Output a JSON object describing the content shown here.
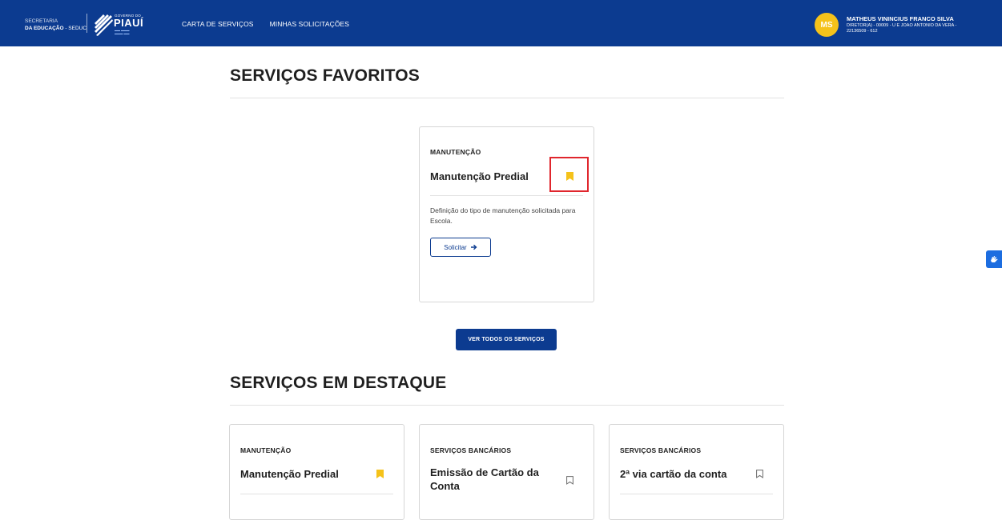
{
  "header": {
    "brand_line1": "SECRETARIA",
    "brand_line2_bold": "DA EDUCAÇÃO",
    "brand_line2_rest": " - SEDUC",
    "gov_small": "GOVERNO DO",
    "gov_big": "PIAUÍ",
    "nav": [
      "CARTA DE SERVIÇOS",
      "MINHAS SOLICITAÇÕES"
    ],
    "user_initials": "MS",
    "user_name": "MATHEUS VININCIUS FRANCO SILVA",
    "user_role": "DIRETOR(A) - 00009 - U E JOAO ANTONIO DA VERA - 22136509 - 612"
  },
  "favorites": {
    "title": "SERVIÇOS FAVORITOS",
    "card": {
      "category": "MANUTENÇÃO",
      "title": "Manutenção Predial",
      "description": "Definição do tipo de manutenção solicitada para Escola.",
      "button": "Solicitar"
    },
    "view_all": "VER TODOS OS SERVIÇOS"
  },
  "featured": {
    "title": "SERVIÇOS EM DESTAQUE",
    "cards": [
      {
        "category": "MANUTENÇÃO",
        "title": "Manutenção Predial"
      },
      {
        "category": "SERVIÇOS BANCÁRIOS",
        "title": "Emissão de Cartão da Conta"
      },
      {
        "category": "SERVIÇOS BANCÁRIOS",
        "title": "2ª via cartão da conta"
      }
    ]
  },
  "colors": {
    "primary": "#0c3b90",
    "bookmark_active": "#f5c21a",
    "highlight": "#e0262d"
  }
}
